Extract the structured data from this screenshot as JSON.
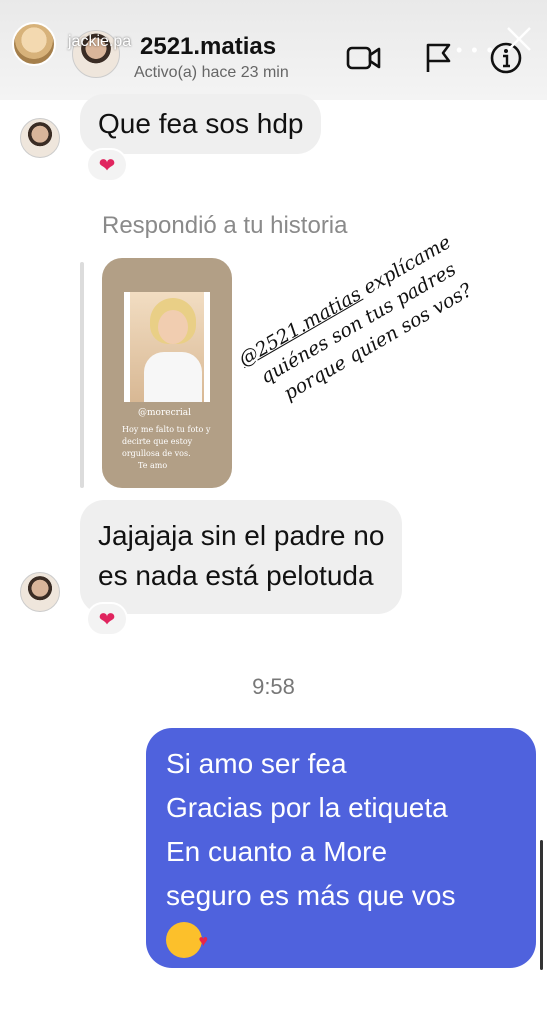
{
  "story_header": {
    "user": "jackie.pa"
  },
  "conversation": {
    "username": "2521.matias",
    "status": "Activo(a) hace 23 min"
  },
  "messages": {
    "m1": "Que fea sos hdp",
    "m1_reaction": "❤",
    "story_reply_label": "Respondió a tu historia",
    "story": {
      "tag": "@morecrial",
      "caption_1": "Hoy me falto tu foto y",
      "caption_2": "decirte que estoy",
      "caption_3": "orgullosa de vos.",
      "caption_4": "Te amo"
    },
    "handwritten": {
      "mention": "@2521.matias",
      "line_1_rest": " explícame",
      "line_2": "quiénes son tus padres",
      "line_3": "porque quien sos vos?"
    },
    "m2_line1": "Jajajaja sin el padre no",
    "m2_line2": "es nada está pelotuda",
    "m2_reaction": "❤",
    "time": "9:58",
    "out_line1": "Si amo ser fea",
    "out_line2": "Gracias por la etiqueta",
    "out_line3": "En cuanto a More",
    "out_line4": "seguro es más que vos"
  },
  "icons": [
    "video-call-icon",
    "flag-icon",
    "info-icon",
    "close-icon",
    "heart-icon",
    "kissing-face-emoji"
  ],
  "colors": {
    "outgoing_bubble": "#4f62dd",
    "incoming_bubble": "#efefef",
    "reaction_heart": "#e0245e"
  }
}
